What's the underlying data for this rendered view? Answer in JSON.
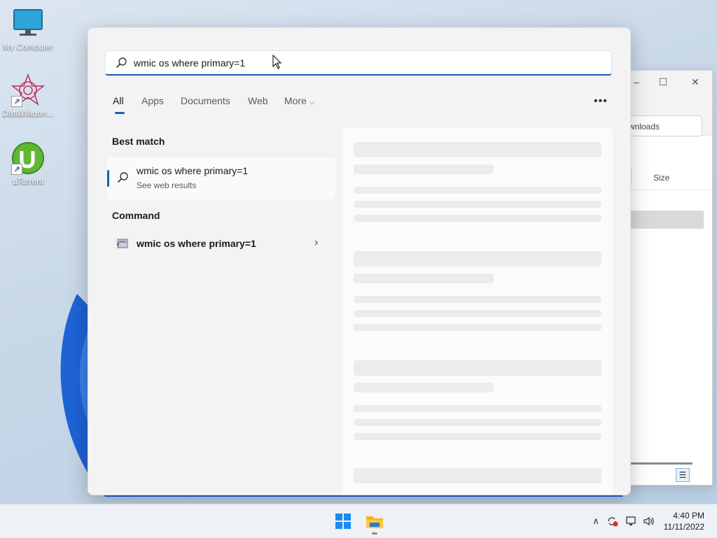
{
  "desktop": {
    "icons": [
      {
        "label": "My Computer"
      },
      {
        "label": "DataWagon..."
      },
      {
        "label": "µTorrent"
      }
    ]
  },
  "explorer": {
    "address_fragment": "wnloads",
    "column_size": "Size"
  },
  "search": {
    "query": "wmic os where primary=1",
    "tabs": [
      "All",
      "Apps",
      "Documents",
      "Web",
      "More"
    ],
    "more_icon": "ellipsis-icon",
    "best_match": {
      "header": "Best match",
      "title": "wmic os where primary=1",
      "subtitle": "See web results"
    },
    "command": {
      "header": "Command",
      "title": "wmic os where primary=1"
    }
  },
  "taskbar": {
    "time": "4:40 PM",
    "date": "11/11/2022"
  },
  "colors": {
    "accent": "#1a5fb4",
    "flyout_bg": "#f3f3f3",
    "taskbar_bg": "#eef1f5"
  }
}
